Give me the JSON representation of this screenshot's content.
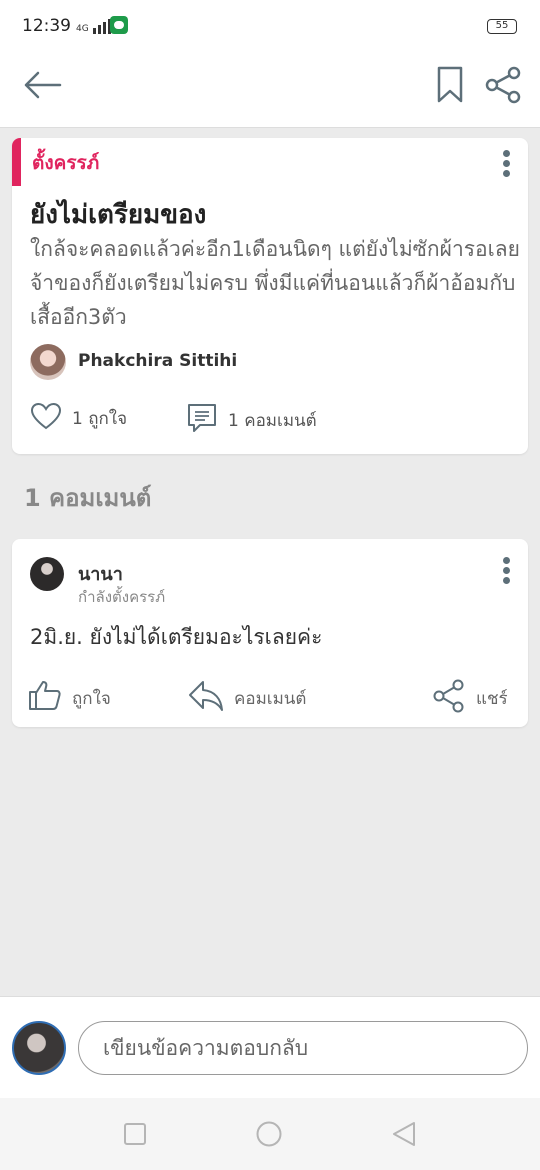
{
  "status_bar": {
    "time": "12:39",
    "network": "4G",
    "battery": "55"
  },
  "app_bar": {
    "back_icon": "arrow-left-icon",
    "bookmark_icon": "bookmark-icon",
    "share_icon": "share-icon"
  },
  "post": {
    "category": "ตั้งครรภ์",
    "accent_color": "#e0245e",
    "title": "ยังไม่เตรียมของ",
    "body": "ใกล้จะคลอดแล้วค่ะอีก1เดือนนิดๆ แต่ยังไม่ซักผ้ารอเลยจ้าของก็ยังเตรียมไม่ครบ พึ่งมีแค่ที่นอนแล้วก็ผ้าอ้อมกับเสื้ออีก3ตัว",
    "author": "Phakchira Sittihi",
    "likes_label": "1 ถูกใจ",
    "comments_label": "1 คอมเมนต์"
  },
  "comments_heading": "1 คอมเมนต์",
  "comment": {
    "author": "นานา",
    "role": "กำลังตั้งครรภ์",
    "text": "2มิ.ย. ยังไม่ได้เตรียมอะไรเลยค่ะ",
    "like_label": "ถูกใจ",
    "reply_label": "คอมเมนต์",
    "share_label": "แชร์"
  },
  "composer": {
    "placeholder": "เขียนข้อความตอบกลับ"
  },
  "nav_bar": {
    "recent_icon": "square-icon",
    "home_icon": "circle-icon",
    "back_icon": "triangle-back-icon"
  }
}
